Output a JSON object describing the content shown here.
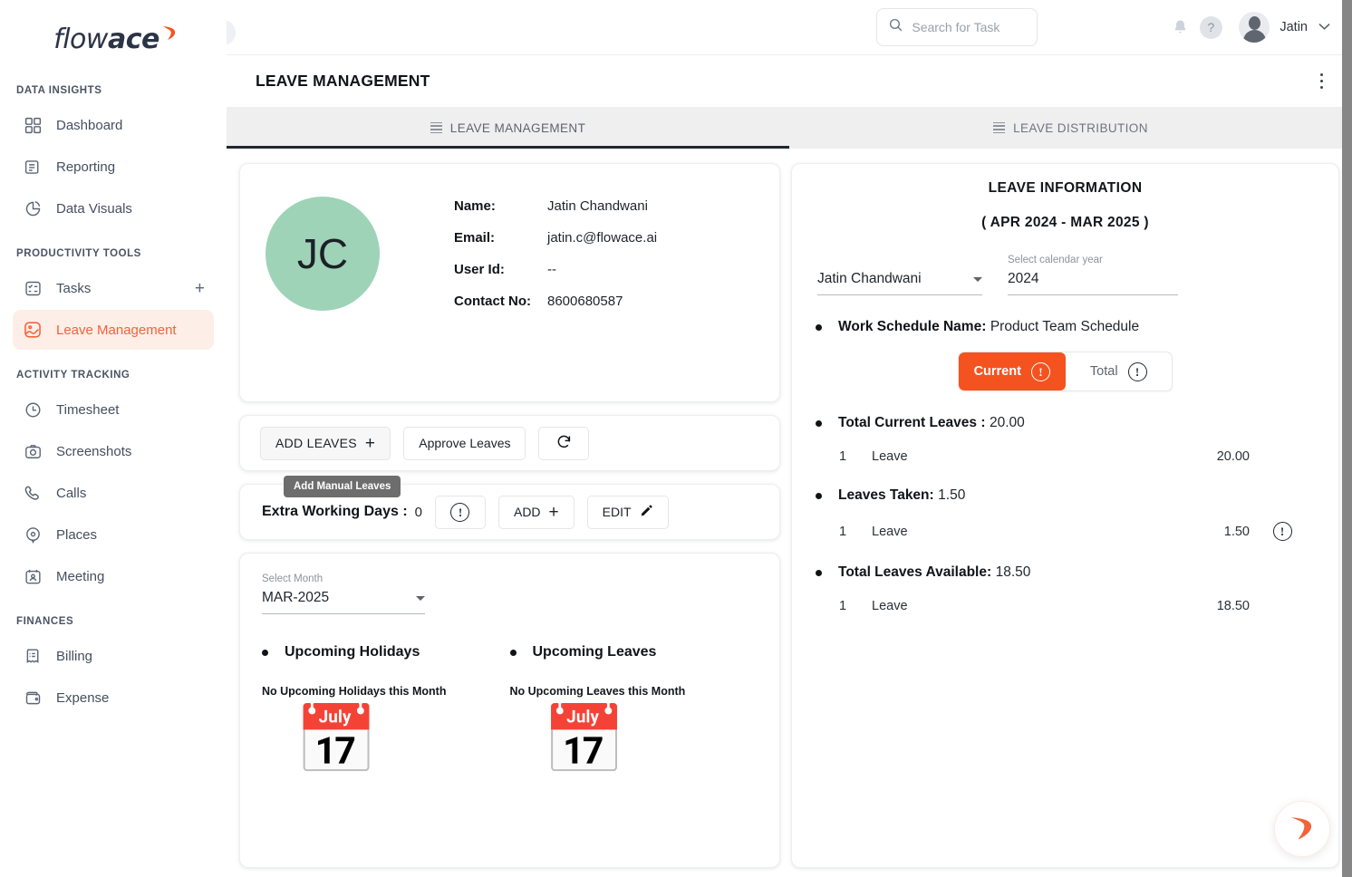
{
  "brand": {
    "logo_light": "flow",
    "logo_bold": "ace",
    "accent_color": "#f4531f",
    "sidebar_active_color": "#f4623a"
  },
  "topbar": {
    "search_placeholder": "Search for Task",
    "search_value": "",
    "help_label": "?",
    "user_name": "Jatin"
  },
  "sidebar": {
    "sections": [
      {
        "title": "DATA INSIGHTS",
        "items": [
          {
            "label": "Dashboard",
            "icon": "grid-icon",
            "active": false
          },
          {
            "label": "Reporting",
            "icon": "report-icon",
            "active": false
          },
          {
            "label": "Data Visuals",
            "icon": "pie-chart-icon",
            "active": false
          }
        ]
      },
      {
        "title": "PRODUCTIVITY TOOLS",
        "items": [
          {
            "label": "Tasks",
            "icon": "checklist-icon",
            "active": false,
            "trailing": "+"
          },
          {
            "label": "Leave Management",
            "icon": "leave-icon",
            "active": true
          }
        ]
      },
      {
        "title": "ACTIVITY TRACKING",
        "items": [
          {
            "label": "Timesheet",
            "icon": "clock-icon",
            "active": false
          },
          {
            "label": "Screenshots",
            "icon": "camera-icon",
            "active": false
          },
          {
            "label": "Calls",
            "icon": "phone-icon",
            "active": false
          },
          {
            "label": "Places",
            "icon": "location-pin-icon",
            "active": false
          },
          {
            "label": "Meeting",
            "icon": "meeting-icon",
            "active": false
          }
        ]
      },
      {
        "title": "FINANCES",
        "items": [
          {
            "label": "Billing",
            "icon": "receipt-icon",
            "active": false
          },
          {
            "label": "Expense",
            "icon": "wallet-icon",
            "active": false
          }
        ]
      }
    ]
  },
  "page": {
    "title": "LEAVE MANAGEMENT",
    "tabs": [
      {
        "label": "LEAVE MANAGEMENT",
        "active": true
      },
      {
        "label": "LEAVE DISTRIBUTION",
        "active": false
      }
    ]
  },
  "profile": {
    "initials": "JC",
    "avatar_color": "#9ed3b7",
    "fields": [
      {
        "label": "Name:",
        "value": "Jatin Chandwani"
      },
      {
        "label": "Email:",
        "value": "jatin.c@flowace.ai"
      },
      {
        "label": "User Id:",
        "value": "--"
      },
      {
        "label": "Contact No:",
        "value": "8600680587"
      }
    ]
  },
  "actions": {
    "add_leaves": "ADD LEAVES",
    "approve_leaves": "Approve Leaves",
    "refresh_icon": "refresh-icon",
    "tooltip": "Add Manual Leaves"
  },
  "extra_working_days": {
    "label": "Extra Working Days :",
    "value": "0",
    "info_icon": "info-exclamation-icon",
    "add_label": "ADD",
    "edit_label": "EDIT"
  },
  "month_panel": {
    "select_month_label": "Select Month",
    "select_month_value": "MAR-2025",
    "holidays": {
      "title": "Upcoming Holidays",
      "empty_text": "No Upcoming Holidays this Month",
      "image": "tear-off-calendar-emoji"
    },
    "leaves": {
      "title": "Upcoming Leaves",
      "empty_text": "No Upcoming Leaves this Month",
      "image": "tear-off-calendar-emoji"
    }
  },
  "leave_information": {
    "title": "LEAVE INFORMATION",
    "period": "( APR  2024  - MAR  2025 )",
    "employee_value": "Jatin Chandwani",
    "year_label": "Select calendar year",
    "year_value": "2024",
    "work_schedule_label": "Work Schedule Name:",
    "work_schedule_value": "Product Team Schedule",
    "toggle": {
      "current": "Current",
      "total": "Total",
      "active": "Current"
    },
    "groups": [
      {
        "label": "Total Current Leaves :",
        "total": "20.00",
        "rows": [
          {
            "num": "1",
            "name": "Leave",
            "value": "20.00",
            "has_info": false
          }
        ]
      },
      {
        "label": "Leaves Taken:",
        "total": "1.50",
        "rows": [
          {
            "num": "1",
            "name": "Leave",
            "value": "1.50",
            "has_info": true
          }
        ]
      },
      {
        "label": "Total Leaves Available:",
        "total": "18.50",
        "rows": [
          {
            "num": "1",
            "name": "Leave",
            "value": "18.50",
            "has_info": false
          }
        ]
      }
    ]
  },
  "fab": {
    "icon": "flowace-swoosh-icon"
  }
}
